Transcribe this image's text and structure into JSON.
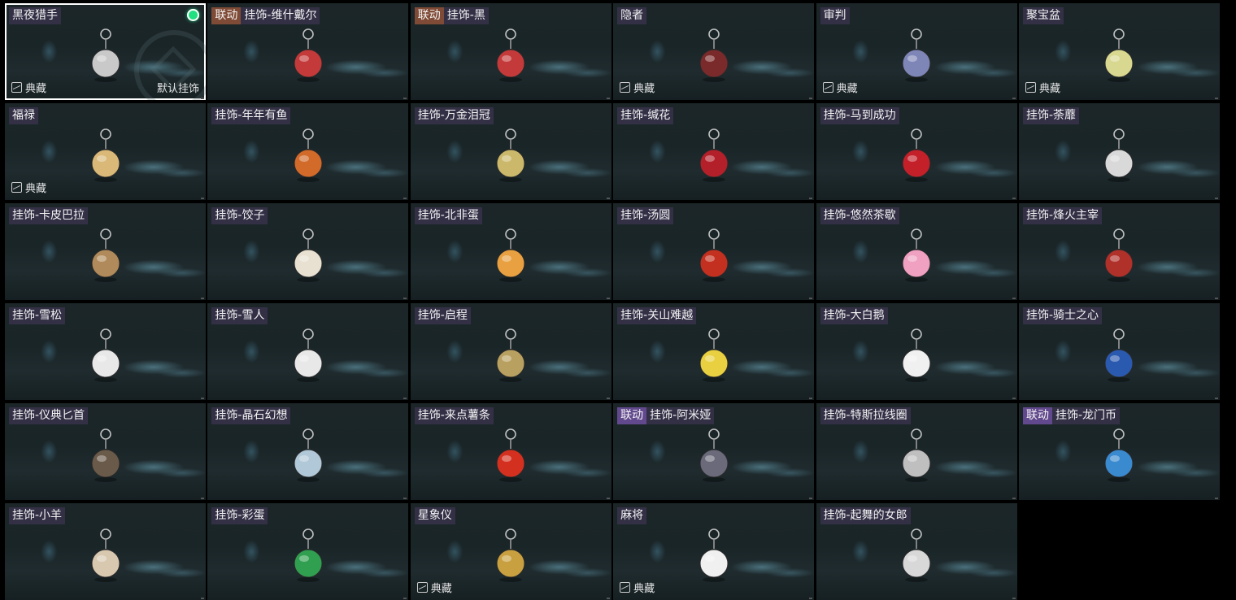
{
  "labels": {
    "collection": "典藏",
    "default_charm": "默认挂饰"
  },
  "rows": [
    [
      {
        "name": "黑夜猎手",
        "collection": true,
        "selected": true,
        "equipped": true,
        "icon": "night-hunter-charm-icon",
        "color": "#c9c9c9"
      },
      {
        "prefix": "联动",
        "prefix_type": "link",
        "name": "挂饰-维什戴尔",
        "icon": "vishdel-card-charm-icon",
        "color": "#c43a3a"
      },
      {
        "prefix": "联动",
        "prefix_type": "link",
        "name": "挂饰-黑",
        "icon": "hei-card-charm-icon",
        "color": "#c43a3a"
      },
      {
        "name": "隐者",
        "collection": true,
        "icon": "hermit-card-charm-icon",
        "color": "#7a2a2a"
      },
      {
        "name": "审判",
        "collection": true,
        "icon": "judgement-card-charm-icon",
        "color": "#7e86b8"
      },
      {
        "name": "聚宝盆",
        "collection": true,
        "icon": "treasure-bowl-charm-icon",
        "color": "#d8d890"
      }
    ],
    [
      {
        "name": "福禄",
        "collection": true,
        "icon": "gourd-charm-icon",
        "color": "#d9b878"
      },
      {
        "name": "挂饰-年年有鱼",
        "icon": "fish-plate-charm-icon",
        "color": "#d26a2a"
      },
      {
        "name": "挂饰-万金泪冠",
        "icon": "burger-charm-icon",
        "color": "#cbb86a"
      },
      {
        "name": "挂饰-缄花",
        "icon": "rose-charm-icon",
        "color": "#b4202a"
      },
      {
        "name": "挂饰-马到成功",
        "icon": "horse-charm-icon",
        "color": "#c4202a"
      },
      {
        "name": "挂饰-荼蘼",
        "icon": "flower-charm-icon",
        "color": "#d9d9d9"
      }
    ],
    [
      {
        "name": "挂饰-卡皮巴拉",
        "icon": "capybara-charm-icon",
        "color": "#b08a5a"
      },
      {
        "name": "挂饰-饺子",
        "icon": "dumpling-charm-icon",
        "color": "#e8e0d0"
      },
      {
        "name": "挂饰-北非蛋",
        "icon": "shakshuka-charm-icon",
        "color": "#e8a040"
      },
      {
        "name": "挂饰-汤圆",
        "icon": "tangyuan-charm-icon",
        "color": "#c43020"
      },
      {
        "name": "挂饰-悠然茶歇",
        "icon": "cupcake-charm-icon",
        "color": "#f0a0c0"
      },
      {
        "name": "挂饰-烽火主宰",
        "icon": "triangle-charm-icon",
        "color": "#b0302a"
      }
    ],
    [
      {
        "name": "挂饰-雪松",
        "icon": "pine-tree-charm-icon",
        "color": "#e8e8e8"
      },
      {
        "name": "挂饰-雪人",
        "icon": "snowman-charm-icon",
        "color": "#e8e8e8"
      },
      {
        "name": "挂饰-启程",
        "icon": "compass-charm-icon",
        "color": "#b8a060"
      },
      {
        "name": "挂饰-关山难越",
        "icon": "gold-bar-charm-icon",
        "color": "#e8d040"
      },
      {
        "name": "挂饰-大白鹅",
        "icon": "goose-charm-icon",
        "color": "#f0f0f0"
      },
      {
        "name": "挂饰-骑士之心",
        "icon": "knight-emblem-charm-icon",
        "color": "#2a5ab0"
      }
    ],
    [
      {
        "name": "挂饰-仪典匕首",
        "icon": "dagger-charm-icon",
        "color": "#6a5a4a"
      },
      {
        "name": "挂饰-晶石幻想",
        "icon": "crystal-cube-charm-icon",
        "color": "#b0c8d8"
      },
      {
        "name": "挂饰-来点薯条",
        "icon": "fries-charm-icon",
        "color": "#d43020"
      },
      {
        "prefix": "联动",
        "prefix_type": "collab",
        "name": "挂饰-阿米娅",
        "icon": "rabbit-charm-icon",
        "color": "#6a6a7a"
      },
      {
        "name": "挂饰-特斯拉线圈",
        "icon": "tesla-coil-charm-icon",
        "color": "#bfbfbf"
      },
      {
        "prefix": "联动",
        "prefix_type": "collab",
        "name": "挂饰-龙门币",
        "icon": "lungmen-coin-charm-icon",
        "color": "#3a8ad0"
      }
    ],
    [
      {
        "name": "挂饰-小羊",
        "icon": "sheep-charm-icon",
        "color": "#d8c8b0"
      },
      {
        "name": "挂饰-彩蛋",
        "icon": "jade-egg-charm-icon",
        "color": "#30a050"
      },
      {
        "name": "星象仪",
        "collection": true,
        "icon": "astrolabe-charm-icon",
        "color": "#c8a040"
      },
      {
        "name": "麻将",
        "collection": true,
        "icon": "mahjong-charm-icon",
        "color": "#f0f0f0"
      },
      {
        "name": "挂饰-起舞的女郎",
        "icon": "dancer-charm-icon",
        "color": "#d8d8d8"
      },
      null
    ]
  ]
}
